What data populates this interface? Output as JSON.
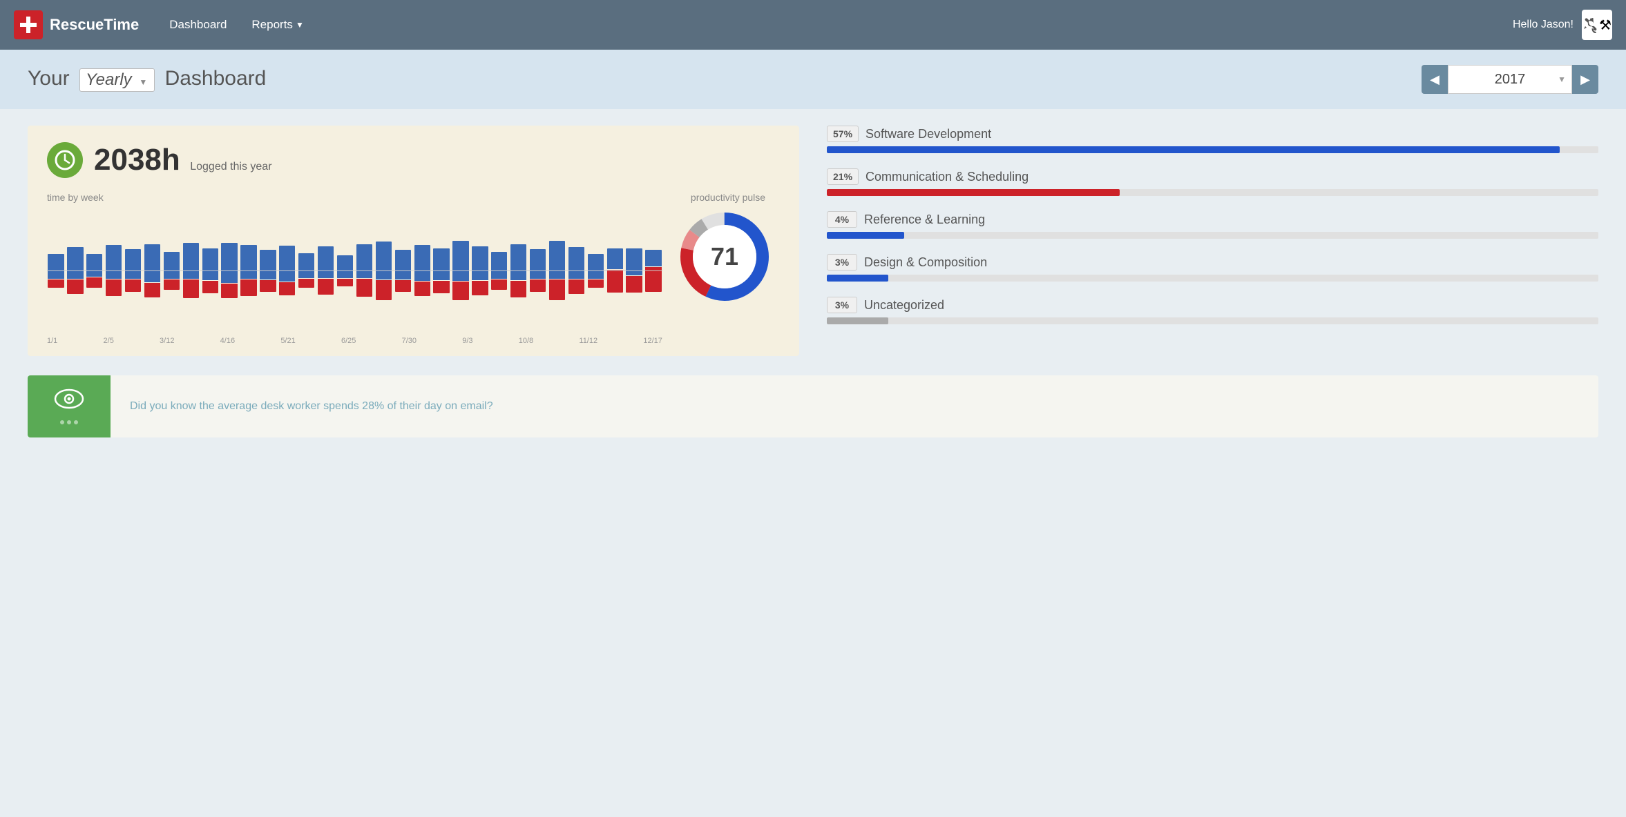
{
  "navbar": {
    "logo_text_light": "Rescue",
    "logo_text_bold": "Time",
    "nav_dashboard": "Dashboard",
    "nav_reports": "Reports",
    "hello_text": "Hello Jason!",
    "tools_icon": "⚙"
  },
  "header": {
    "prefix": "Your",
    "period_type": "Yearly",
    "suffix": "Dashboard",
    "year": "2017"
  },
  "summary": {
    "hours": "2038h",
    "label": "Logged this year",
    "chart_label": "time by week",
    "pulse_label": "productivity pulse",
    "pulse_score": "71",
    "x_labels": [
      "1/1",
      "2/5",
      "3/12",
      "4/16",
      "5/21",
      "6/25",
      "7/30",
      "9/3",
      "10/8",
      "11/12",
      "12/17"
    ]
  },
  "stats": [
    {
      "pct": "57%",
      "name": "Software Development",
      "color": "#2255cc",
      "bar_pct": 95
    },
    {
      "pct": "21%",
      "name": "Communication & Scheduling",
      "color": "#cc2229",
      "bar_pct": 38
    },
    {
      "pct": "4%",
      "name": "Reference & Learning",
      "color": "#2255cc",
      "bar_pct": 10
    },
    {
      "pct": "3%",
      "name": "Design & Composition",
      "color": "#2255cc",
      "bar_pct": 8
    },
    {
      "pct": "3%",
      "name": "Uncategorized",
      "color": "#aaaaaa",
      "bar_pct": 8
    }
  ],
  "banner": {
    "text": "Did you know the average desk worker spends 28% of their day on email?"
  },
  "bars": [
    {
      "pos": 60,
      "neg": 20
    },
    {
      "pos": 75,
      "neg": 35
    },
    {
      "pos": 55,
      "neg": 25
    },
    {
      "pos": 80,
      "neg": 40
    },
    {
      "pos": 70,
      "neg": 30
    },
    {
      "pos": 90,
      "neg": 35
    },
    {
      "pos": 65,
      "neg": 25
    },
    {
      "pos": 85,
      "neg": 45
    },
    {
      "pos": 75,
      "neg": 30
    },
    {
      "pos": 95,
      "neg": 35
    },
    {
      "pos": 80,
      "neg": 40
    },
    {
      "pos": 70,
      "neg": 28
    },
    {
      "pos": 85,
      "neg": 32
    },
    {
      "pos": 60,
      "neg": 22
    },
    {
      "pos": 75,
      "neg": 38
    },
    {
      "pos": 55,
      "neg": 18
    },
    {
      "pos": 80,
      "neg": 42
    },
    {
      "pos": 90,
      "neg": 48
    },
    {
      "pos": 70,
      "neg": 28
    },
    {
      "pos": 85,
      "neg": 35
    },
    {
      "pos": 75,
      "neg": 30
    },
    {
      "pos": 95,
      "neg": 45
    },
    {
      "pos": 80,
      "neg": 35
    },
    {
      "pos": 65,
      "neg": 25
    },
    {
      "pos": 85,
      "neg": 40
    },
    {
      "pos": 70,
      "neg": 30
    },
    {
      "pos": 90,
      "neg": 50
    },
    {
      "pos": 75,
      "neg": 35
    },
    {
      "pos": 60,
      "neg": 20
    },
    {
      "pos": 50,
      "neg": 55
    },
    {
      "pos": 65,
      "neg": 40
    },
    {
      "pos": 40,
      "neg": 60
    }
  ]
}
